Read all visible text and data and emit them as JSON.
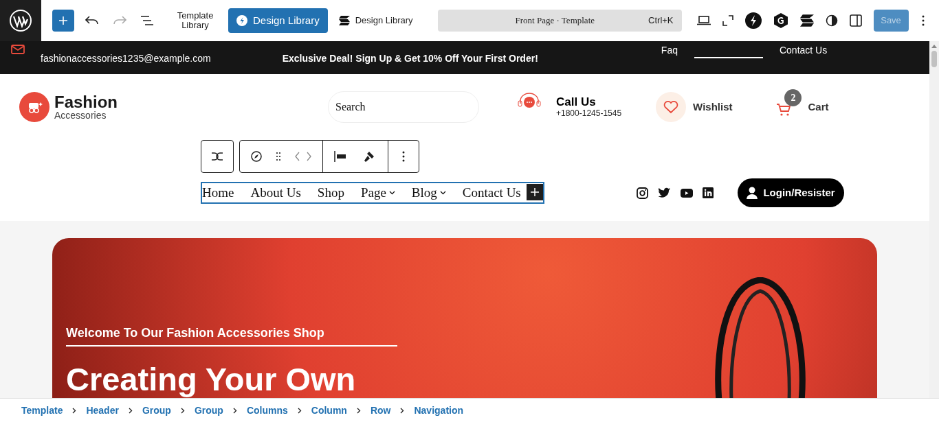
{
  "editor_toolbar": {
    "template_library": "Template Library",
    "buttons": [
      {
        "label": "Design Library",
        "kind": "primary"
      },
      {
        "label": "Design Library",
        "kind": "plain"
      }
    ],
    "command_bar": {
      "title": "Front Page · Template",
      "shortcut": "Ctrl+K"
    },
    "save": {
      "label": "Save",
      "disabled": true
    }
  },
  "top_bar": {
    "email": "fashionaccessories1235@example.com",
    "promo": "Exclusive Deal! Sign Up & Get 10% Off Your First Order!",
    "links": [
      "Faq",
      "Contact Us"
    ]
  },
  "header": {
    "logo": {
      "title": "Fashion",
      "subtitle": "Accessories"
    },
    "search": {
      "placeholder": "Search"
    },
    "call": {
      "title": "Call Us",
      "phone": "+1800-1245-1545"
    },
    "wishlist": "Wishlist",
    "cart": {
      "label": "Cart",
      "count": "2"
    }
  },
  "navigation": {
    "items": [
      {
        "label": "Home",
        "submenu": false
      },
      {
        "label": "About Us",
        "submenu": false
      },
      {
        "label": "Shop",
        "submenu": false
      },
      {
        "label": "Page",
        "submenu": true
      },
      {
        "label": "Blog",
        "submenu": true
      },
      {
        "label": "Contact Us",
        "submenu": false
      }
    ],
    "login": "Login/Resister"
  },
  "hero": {
    "eyebrow": "Welcome To Our Fashion Accessories Shop",
    "heading": "Creating Your Own"
  },
  "breadcrumb": [
    "Template",
    "Header",
    "Group",
    "Group",
    "Columns",
    "Column",
    "Row",
    "Navigation"
  ]
}
